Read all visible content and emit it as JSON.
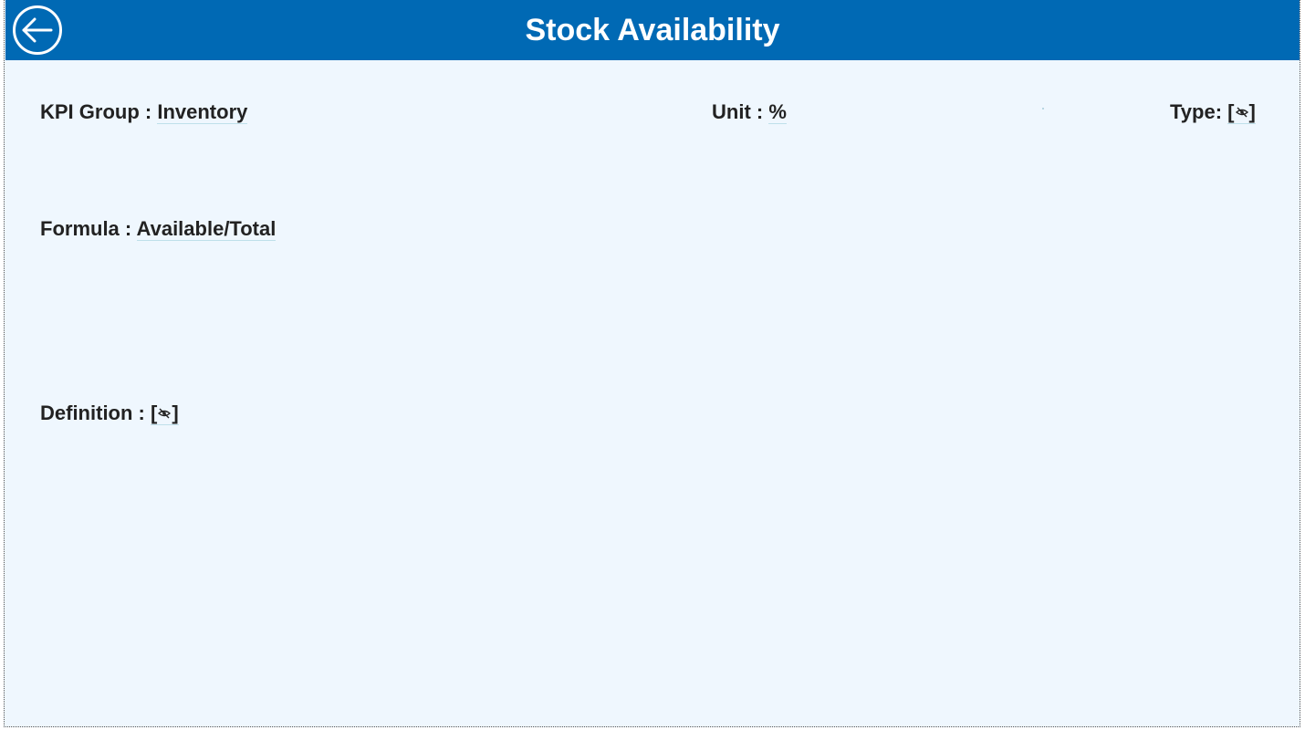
{
  "header": {
    "title": "Stock Availability",
    "back_icon": "arrow-left-circle-icon",
    "background_color": "#0069b4"
  },
  "fields": {
    "kpi_group": {
      "label": "KPI Group :",
      "value": "Inventory"
    },
    "unit": {
      "label": "Unit :",
      "value": "%"
    },
    "type": {
      "label": "Type:",
      "bracket_open": "[",
      "bracket_close": "]",
      "icon": "eye-off-icon"
    },
    "formula": {
      "label": "Formula :",
      "value": "Available/Total"
    },
    "definition": {
      "label": "Definition :",
      "bracket_open": "[",
      "bracket_close": "]",
      "icon": "eye-off-icon"
    }
  },
  "colors": {
    "panel_background": "#eff7fe",
    "text": "#222222",
    "underline": "#bfe0ea"
  }
}
